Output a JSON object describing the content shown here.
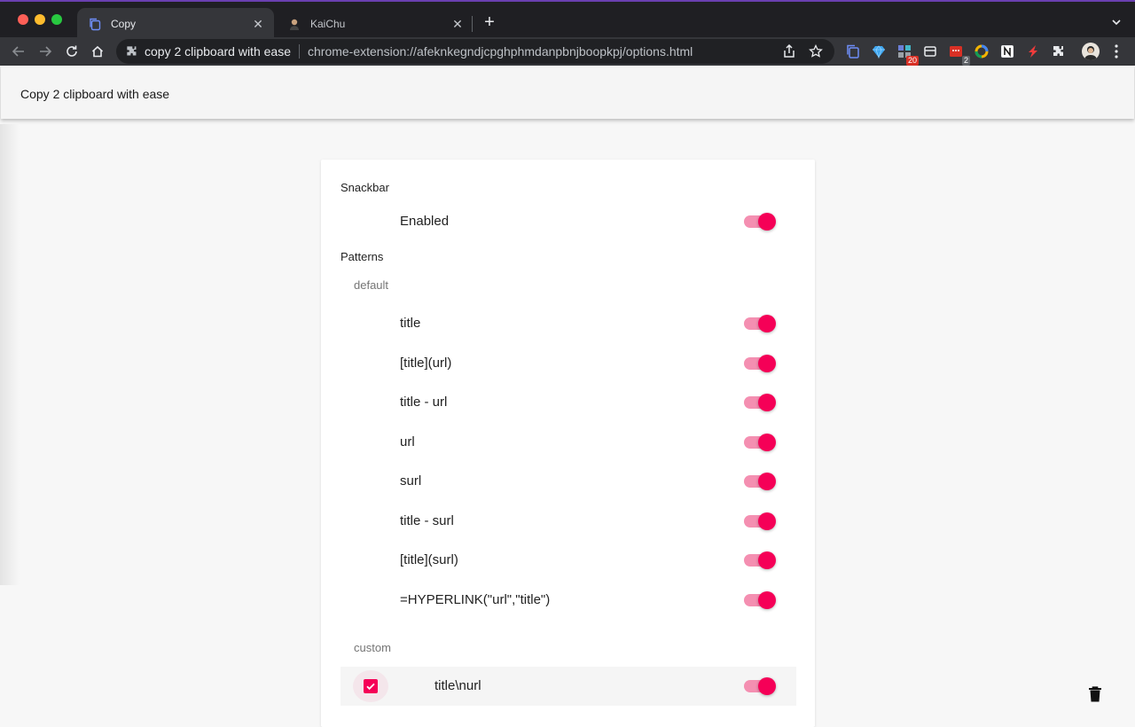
{
  "browser": {
    "tabs": [
      {
        "title": "Copy",
        "active": true
      },
      {
        "title": "KaiChu",
        "active": false
      }
    ],
    "omnibox": {
      "site_name": "copy 2 clipboard with ease",
      "url": "chrome-extension://afeknkegndjcpghphmdanpbnjboopkpj/options.html"
    },
    "extensions": [
      {
        "icon": "copy-extension-icon",
        "badge": ""
      },
      {
        "icon": "gem-icon",
        "badge": ""
      },
      {
        "icon": "grid-extension-icon",
        "badge": "20"
      },
      {
        "icon": "inbox-icon",
        "badge": ""
      },
      {
        "icon": "red-calendar-icon",
        "badge": "2"
      },
      {
        "icon": "color-ring-icon",
        "badge": ""
      },
      {
        "icon": "notion-icon",
        "badge": ""
      },
      {
        "icon": "lightning-icon",
        "badge": ""
      },
      {
        "icon": "puzzle-icon",
        "badge": ""
      }
    ]
  },
  "app": {
    "title": "Copy 2 clipboard with ease"
  },
  "options": {
    "snackbar": {
      "heading": "Snackbar",
      "items": [
        {
          "label": "Enabled",
          "on": true
        }
      ]
    },
    "patterns": {
      "heading": "Patterns",
      "default_heading": "default",
      "default_items": [
        {
          "label": "title",
          "on": true
        },
        {
          "label": "[title](url)",
          "on": true
        },
        {
          "label": "title - url",
          "on": true
        },
        {
          "label": "url",
          "on": true
        },
        {
          "label": "surl",
          "on": true
        },
        {
          "label": "title - surl",
          "on": true
        },
        {
          "label": "[title](surl)",
          "on": true
        },
        {
          "label": "=HYPERLINK(\"url\",\"title\")",
          "on": true
        }
      ],
      "custom_heading": "custom",
      "custom_items": [
        {
          "label": "title\\nurl",
          "on": true,
          "checked": true
        }
      ]
    }
  },
  "colors": {
    "accent": "#f50057",
    "accent_track": "#f48fb1"
  }
}
